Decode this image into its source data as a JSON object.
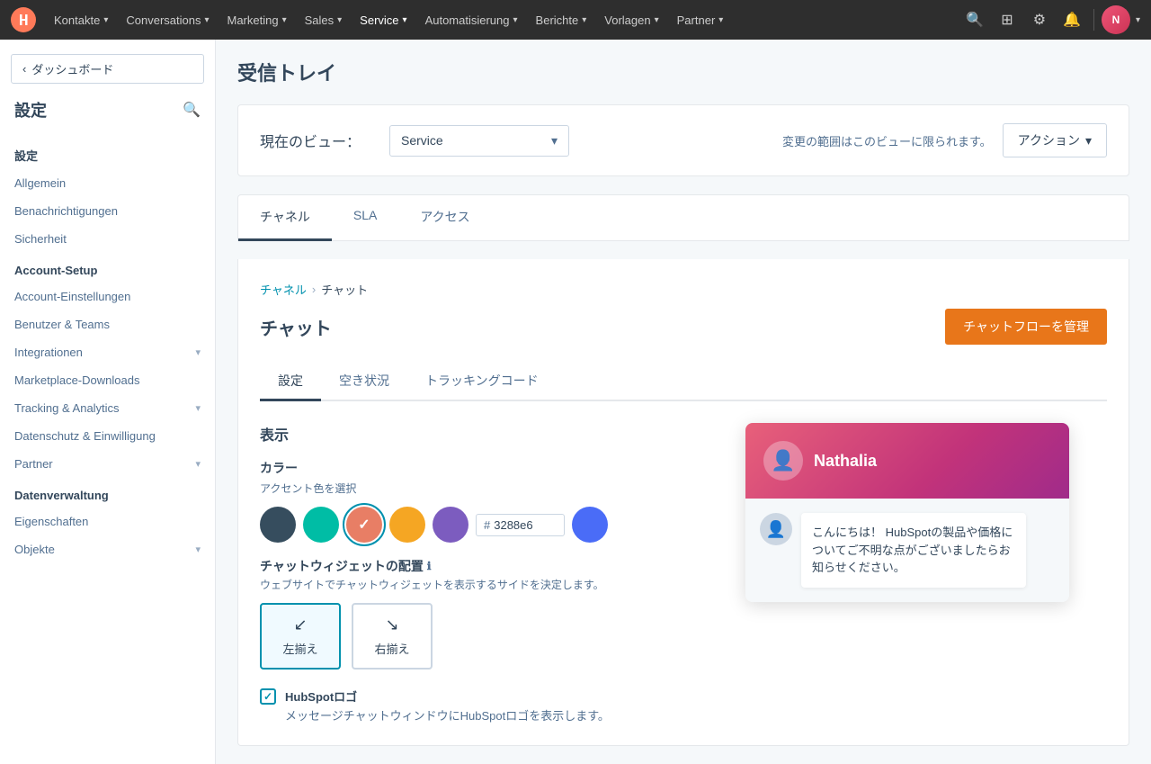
{
  "topnav": {
    "items": [
      {
        "label": "Kontakte",
        "id": "kontakte"
      },
      {
        "label": "Conversations",
        "id": "conversations"
      },
      {
        "label": "Marketing",
        "id": "marketing"
      },
      {
        "label": "Sales",
        "id": "sales"
      },
      {
        "label": "Service",
        "id": "service"
      },
      {
        "label": "Automatisierung",
        "id": "automatisierung"
      },
      {
        "label": "Berichte",
        "id": "berichte"
      },
      {
        "label": "Vorlagen",
        "id": "vorlagen"
      },
      {
        "label": "Partner",
        "id": "partner"
      }
    ]
  },
  "sidebar": {
    "back_label": "ダッシュボード",
    "title": "設定",
    "sections": [
      {
        "title": "設定",
        "items": [
          {
            "label": "Allgemein",
            "id": "allgemein"
          },
          {
            "label": "Benachrichtigungen",
            "id": "benachrichtigungen"
          },
          {
            "label": "Sicherheit",
            "id": "sicherheit"
          }
        ]
      },
      {
        "title": "Account-Setup",
        "items": [
          {
            "label": "Account-Einstellungen",
            "id": "account-einstellungen"
          },
          {
            "label": "Benutzer & Teams",
            "id": "benutzer-teams"
          },
          {
            "label": "Integrationen",
            "id": "integrationen",
            "has_chevron": true
          },
          {
            "label": "Marketplace-Downloads",
            "id": "marketplace-downloads"
          },
          {
            "label": "Tracking & Analytics",
            "id": "tracking-analytics",
            "has_chevron": true
          },
          {
            "label": "Datenschutz & Einwilligung",
            "id": "datenschutz"
          },
          {
            "label": "Partner",
            "id": "partner",
            "has_chevron": true
          }
        ]
      },
      {
        "title": "Datenverwaltung",
        "items": [
          {
            "label": "Eigenschaften",
            "id": "eigenschaften"
          },
          {
            "label": "Objekte",
            "id": "objekte",
            "has_chevron": true
          }
        ]
      }
    ]
  },
  "page": {
    "title": "受信トレイ",
    "view_label": "現在のビュー：",
    "view_value": "Service",
    "view_hint": "変更の範囲はこのビューに限られます。",
    "action_btn": "アクション",
    "tabs": [
      {
        "label": "チャネル",
        "id": "channel",
        "active": true
      },
      {
        "label": "SLA",
        "id": "sla"
      },
      {
        "label": "アクセス",
        "id": "access"
      }
    ],
    "breadcrumb": {
      "link": "チャネル",
      "sep": "›",
      "current": "チャット"
    },
    "section_title": "チャット",
    "manage_btn": "チャットフローを管理",
    "inner_tabs": [
      {
        "label": "設定",
        "id": "settings",
        "active": true
      },
      {
        "label": "空き状況",
        "id": "availability"
      },
      {
        "label": "トラッキングコード",
        "id": "tracking"
      }
    ],
    "display_section": "表示",
    "color_label": "カラー",
    "color_sublabel": "アクセント色を選択",
    "swatches": [
      {
        "color": "#364d5e",
        "id": "dark-blue"
      },
      {
        "color": "#00bda5",
        "id": "teal"
      },
      {
        "color": "#e87e65",
        "id": "salmon",
        "selected": true
      },
      {
        "color": "#f5a623",
        "id": "orange"
      },
      {
        "color": "#7c5cbf",
        "id": "purple"
      }
    ],
    "hex_value": "3288e6",
    "apply_color": "#4a6cf7",
    "placement_label": "チャットウィジェットの配置",
    "placement_sublabel": "ウェブサイトでチャットウィジェットを表示するサイドを決定します。",
    "placement_options": [
      {
        "label": "左揃え",
        "id": "left",
        "icon": "↙",
        "selected": true
      },
      {
        "label": "右揃え",
        "id": "right",
        "icon": "↘"
      }
    ],
    "hubspot_logo_title": "HubSpotロゴ",
    "hubspot_logo_desc": "メッセージチャットウィンドウにHubSpotロゴを表示します。",
    "preview": {
      "name": "Nathalia",
      "message": "こんにちは！ HubSpotの製品や価格についてご不明な点がございましたらお知らせください。"
    }
  }
}
